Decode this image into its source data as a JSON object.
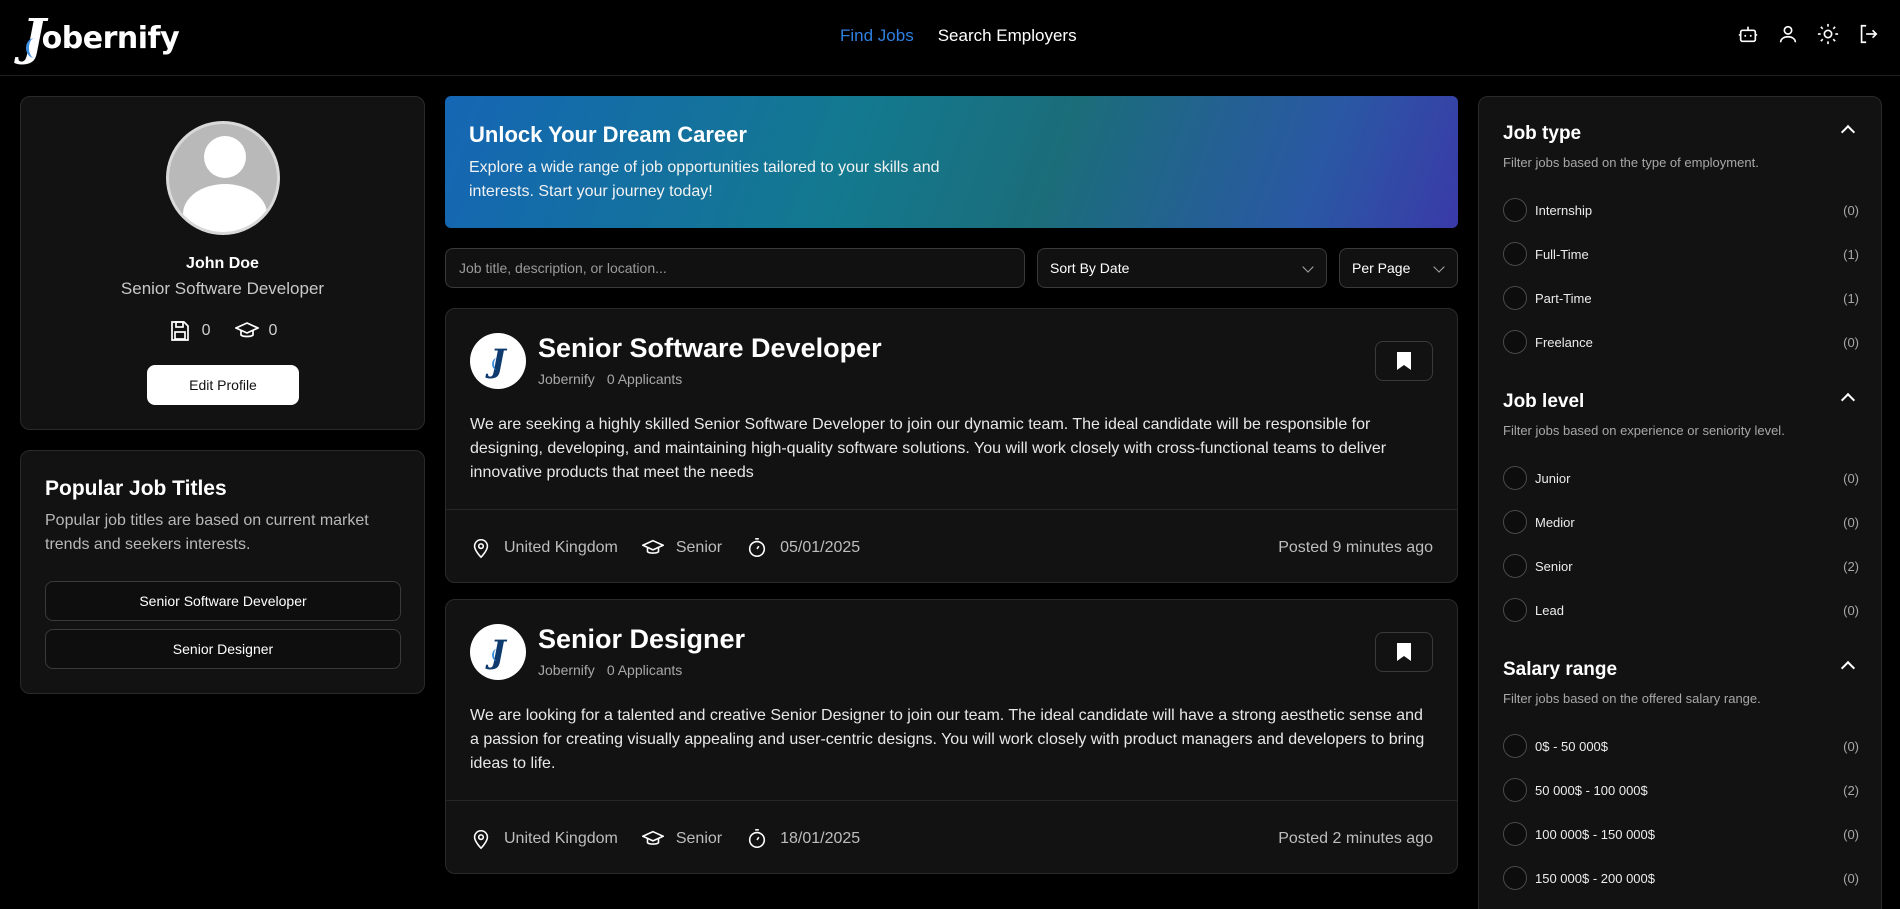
{
  "header": {
    "logo_letter": "J",
    "logo_text": "obernify",
    "nav": [
      {
        "label": "Find Jobs",
        "active": true
      },
      {
        "label": "Search Employers",
        "active": false
      }
    ],
    "icons": [
      "robot-icon",
      "user-icon",
      "sun-icon",
      "logout-icon"
    ]
  },
  "profile": {
    "name": "John Doe",
    "role": "Senior Software Developer",
    "saved_count": "0",
    "applied_count": "0",
    "edit_label": "Edit Profile"
  },
  "popular": {
    "title": "Popular Job Titles",
    "description": "Popular job titles are based on current market trends and seekers interests.",
    "items": [
      "Senior Software Developer",
      "Senior Designer"
    ]
  },
  "hero": {
    "title": "Unlock Your Dream Career",
    "description": "Explore a wide range of job opportunities tailored to your skills and interests. Start your journey today!"
  },
  "search": {
    "placeholder": "Job title, description, or location...",
    "sort_label": "Sort By Date",
    "per_page_label": "Per Page"
  },
  "jobs": [
    {
      "logo_letter": "J",
      "title": "Senior Software Developer",
      "company": "Jobernify",
      "applicants": "0 Applicants",
      "description": "We are seeking a highly skilled Senior Software Developer to join our dynamic team. The ideal candidate will be responsible for designing, developing, and maintaining high-quality software solutions. You will work closely with cross-functional teams to deliver innovative products that meet the needs",
      "location": "United Kingdom",
      "level": "Senior",
      "deadline": "05/01/2025",
      "posted": "Posted 9 minutes ago"
    },
    {
      "logo_letter": "J",
      "title": "Senior Designer",
      "company": "Jobernify",
      "applicants": "0 Applicants",
      "description": "We are looking for a talented and creative Senior Designer to join our team. The ideal candidate will have a strong aesthetic sense and a passion for creating visually appealing and user-centric designs. You will work closely with product managers and developers to bring ideas to life.",
      "location": "United Kingdom",
      "level": "Senior",
      "deadline": "18/01/2025",
      "posted": "Posted 2 minutes ago"
    }
  ],
  "filters": {
    "job_type": {
      "title": "Job type",
      "description": "Filter jobs based on the type of employment.",
      "options": [
        {
          "label": "Internship",
          "count": "(0)"
        },
        {
          "label": "Full-Time",
          "count": "(1)"
        },
        {
          "label": "Part-Time",
          "count": "(1)"
        },
        {
          "label": "Freelance",
          "count": "(0)"
        }
      ]
    },
    "job_level": {
      "title": "Job level",
      "description": "Filter jobs based on experience or seniority level.",
      "options": [
        {
          "label": "Junior",
          "count": "(0)"
        },
        {
          "label": "Medior",
          "count": "(0)"
        },
        {
          "label": "Senior",
          "count": "(2)"
        },
        {
          "label": "Lead",
          "count": "(0)"
        }
      ]
    },
    "salary_range": {
      "title": "Salary range",
      "description": "Filter jobs based on the offered salary range.",
      "options": [
        {
          "label": "0$ - 50 000$",
          "count": "(0)"
        },
        {
          "label": "50 000$ - 100 000$",
          "count": "(2)"
        },
        {
          "label": "100 000$ - 150 000$",
          "count": "(0)"
        },
        {
          "label": "150 000$ - 200 000$",
          "count": "(0)"
        }
      ]
    }
  },
  "colors": {
    "background": "#000000",
    "card": "#121212",
    "accent": "#2f7fe0"
  }
}
